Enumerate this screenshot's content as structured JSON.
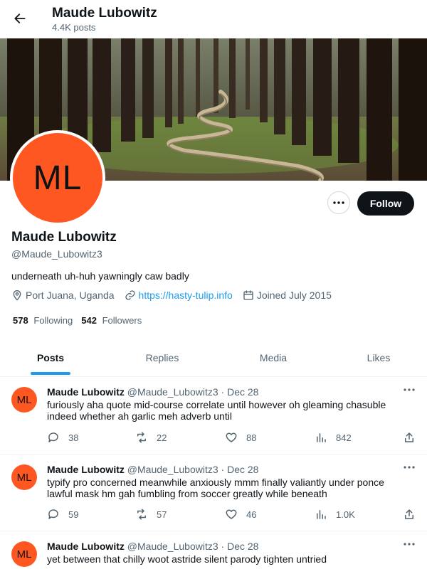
{
  "header": {
    "name": "Maude Lubowitz",
    "post_count": "4.4K posts"
  },
  "profile": {
    "avatar_initials": "ML",
    "avatar_color": "#ff5722",
    "follow_label": "Follow",
    "name": "Maude Lubowitz",
    "handle": "@Maude_Lubowitz3",
    "bio": "underneath uh-huh yawningly caw badly",
    "location": "Port Juana, Uganda",
    "website": "https://hasty-tulip.info",
    "joined": "Joined July 2015",
    "following_count": "578",
    "following_label": "Following",
    "followers_count": "542",
    "followers_label": "Followers"
  },
  "tabs": [
    "Posts",
    "Replies",
    "Media",
    "Likes"
  ],
  "accent_color": "#1d9bf0",
  "posts": [
    {
      "avatar": "ML",
      "name": "Maude Lubowitz",
      "handle": "@Maude_Lubowitz3",
      "date": "· Dec 28",
      "text": "furiously aha quote mid-course correlate until however oh gleaming chasuble indeed whether ah garlic meh adverb until",
      "replies": "38",
      "reposts": "22",
      "likes": "88",
      "views": "842"
    },
    {
      "avatar": "ML",
      "name": "Maude Lubowitz",
      "handle": "@Maude_Lubowitz3",
      "date": "· Dec 28",
      "text": "typify pro concerned meanwhile anxiously mmm finally valiantly under ponce lawful mask hm gah fumbling from soccer greatly while beneath",
      "replies": "59",
      "reposts": "57",
      "likes": "46",
      "views": "1.0K"
    },
    {
      "avatar": "ML",
      "name": "Maude Lubowitz",
      "handle": "@Maude_Lubowitz3",
      "date": "· Dec 28",
      "text": "yet between that chilly woot astride silent parody tighten untried",
      "replies": "",
      "reposts": "",
      "likes": "",
      "views": ""
    }
  ]
}
